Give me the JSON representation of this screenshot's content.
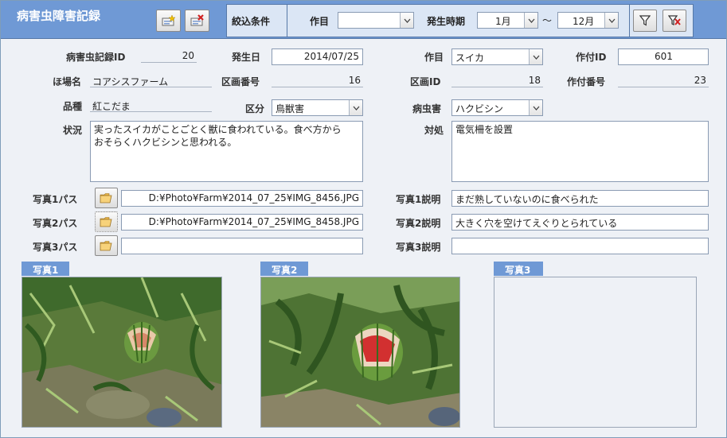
{
  "header": {
    "title": "病害虫障害記録",
    "filter_label": "絞込条件",
    "crop_label": "作目",
    "crop_value": "",
    "period_label": "発生時期",
    "month_from": "1月",
    "tilde": "～",
    "month_to": "12月"
  },
  "icons": {
    "new_record": "new-record-icon",
    "delete_record": "delete-record-icon",
    "filter": "filter-icon",
    "clear_filter": "clear-filter-icon",
    "folder": "folder-icon"
  },
  "colors": {
    "header_bg": "#6f99d5",
    "form_bg": "#eef1f6",
    "filter_bg": "#dbe6f5"
  },
  "form": {
    "record_id_label": "病害虫記録ID",
    "record_id": "20",
    "date_label": "発生日",
    "date": "2014/07/25",
    "crop_label": "作目",
    "crop": "スイカ",
    "planting_id_label": "作付ID",
    "planting_id": "601",
    "field_label": "ほ場名",
    "field": "コアシスファーム",
    "plot_no_label": "区画番号",
    "plot_no": "16",
    "plot_id_label": "区画ID",
    "plot_id": "18",
    "planting_no_label": "作付番号",
    "planting_no": "23",
    "variety_label": "品種",
    "variety": "紅こだま",
    "category_label": "区分",
    "category": "鳥獣害",
    "pest_label": "病虫害",
    "pest": "ハクビシン",
    "status_label": "状況",
    "status": "実ったスイカがことごとく獣に食われている。食べ方から\nおそらくハクビシンと思われる。",
    "action_label": "対処",
    "action": "電気柵を設置",
    "photo1_path_label": "写真1パス",
    "photo1_path": "D:¥Photo¥Farm¥2014_07_25¥IMG_8456.JPG",
    "photo2_path_label": "写真2パス",
    "photo2_path": "D:¥Photo¥Farm¥2014_07_25¥IMG_8458.JPG",
    "photo3_path_label": "写真3パス",
    "photo3_path": "",
    "photo1_desc_label": "写真1説明",
    "photo1_desc": "まだ熟していないのに食べられた",
    "photo2_desc_label": "写真2説明",
    "photo2_desc": "大きく穴を空けてえぐりとられている",
    "photo3_desc_label": "写真3説明",
    "photo3_desc": ""
  },
  "photos": {
    "photo1_label": "写真1",
    "photo2_label": "写真2",
    "photo3_label": "写真3"
  }
}
